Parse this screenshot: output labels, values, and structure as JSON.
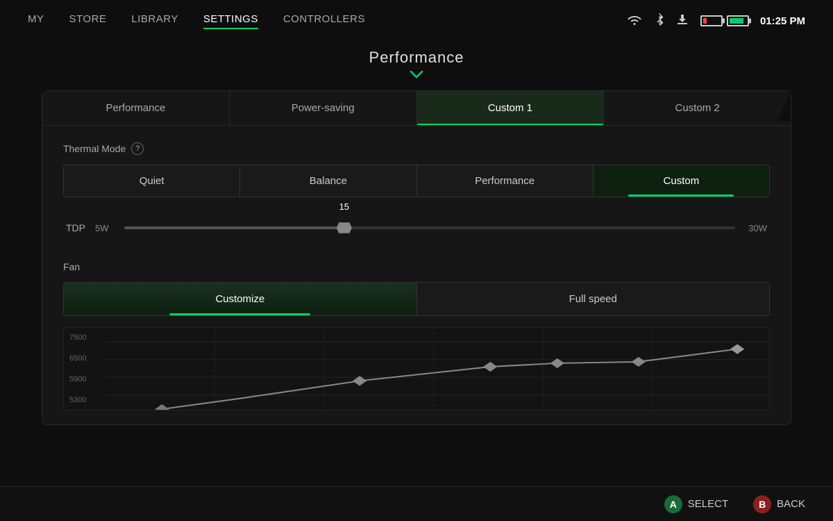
{
  "nav": {
    "items": [
      {
        "label": "MY",
        "active": false
      },
      {
        "label": "STORE",
        "active": false
      },
      {
        "label": "LIBRARY",
        "active": false
      },
      {
        "label": "SETTINGS",
        "active": true
      },
      {
        "label": "CONTROLLERS",
        "active": false
      }
    ]
  },
  "status": {
    "time": "01:25 PM",
    "wifi_icon": "📶",
    "bluetooth_icon": "🔷",
    "download_icon": "⬇"
  },
  "page_title": "Performance",
  "tabs": [
    {
      "label": "Performance",
      "active": false
    },
    {
      "label": "Power-saving",
      "active": false
    },
    {
      "label": "Custom 1",
      "active": true
    },
    {
      "label": "Custom 2",
      "active": false
    }
  ],
  "thermal": {
    "section_label": "Thermal Mode",
    "options": [
      {
        "label": "Quiet",
        "active": false
      },
      {
        "label": "Balance",
        "active": false
      },
      {
        "label": "Performance",
        "active": false
      },
      {
        "label": "Custom",
        "active": true
      }
    ]
  },
  "tdp": {
    "label": "TDP",
    "min": "5W",
    "max": "30W",
    "value": "15",
    "fill_pct": 36
  },
  "fan": {
    "section_label": "Fan",
    "options": [
      {
        "label": "Customize",
        "active": true
      },
      {
        "label": "Full speed",
        "active": false
      }
    ]
  },
  "chart": {
    "y_labels": [
      "7500",
      "6500",
      "5900",
      "5300"
    ],
    "points": [
      {
        "x": 20,
        "y": 85
      },
      {
        "x": 40,
        "y": 80
      },
      {
        "x": 58,
        "y": 65
      },
      {
        "x": 72,
        "y": 50
      },
      {
        "x": 84,
        "y": 42
      },
      {
        "x": 94,
        "y": 30
      }
    ]
  },
  "bottom": {
    "select_label": "SELECT",
    "back_label": "BACK",
    "select_badge": "A",
    "back_badge": "B"
  }
}
